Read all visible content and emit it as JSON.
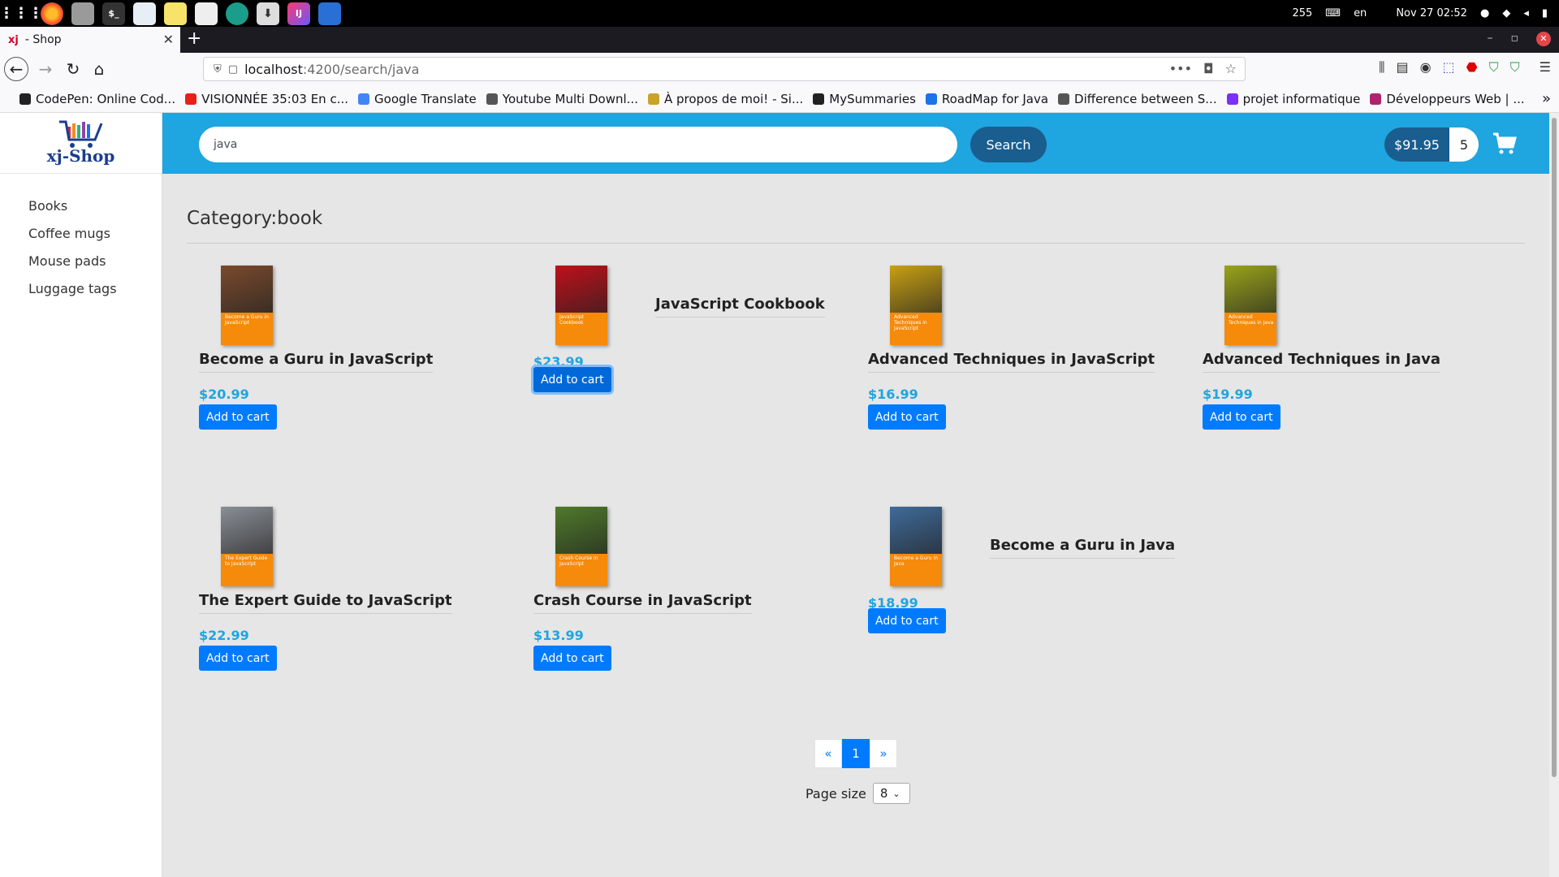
{
  "system": {
    "apps": [
      "grid-icon",
      "firefox-icon",
      "files-icon",
      "terminal-icon",
      "finder-icon",
      "notes-icon",
      "clipboard-icon",
      "chrome-icon",
      "downloads-icon",
      "intellij-icon",
      "docs-icon"
    ],
    "tray": {
      "shield_count": "255",
      "lang": "en",
      "datetime": "Nov 27  02:52"
    }
  },
  "browser": {
    "tab_title": "- Shop",
    "tab_favicon": "xj",
    "url_host": "localhost",
    "url_path": ":4200/search/java",
    "bookmarks": [
      {
        "label": "CodePen: Online Cod...",
        "icon": "codepen-icon",
        "color": "#222"
      },
      {
        "label": "VISIONNÉE 35:03 En c...",
        "icon": "youtube-icon",
        "color": "#e62117"
      },
      {
        "label": "Google Translate",
        "icon": "translate-icon",
        "color": "#4285f4"
      },
      {
        "label": "Youtube Multi Downl...",
        "icon": "globe-icon",
        "color": "#555"
      },
      {
        "label": "À propos de moi! - Si...",
        "icon": "page-icon",
        "color": "#c9a227"
      },
      {
        "label": "MySummaries",
        "icon": "github-icon",
        "color": "#222"
      },
      {
        "label": "RoadMap for Java",
        "icon": "roadmap-icon",
        "color": "#1a73e8"
      },
      {
        "label": "Difference between S...",
        "icon": "diamond-icon",
        "color": "#555"
      },
      {
        "label": "projet informatique",
        "icon": "project-icon",
        "color": "#7b2ff7"
      },
      {
        "label": "Développeurs Web | ...",
        "icon": "web-dev-icon",
        "color": "#b0226d"
      }
    ]
  },
  "app": {
    "logo_text": "xj-Shop",
    "categories": [
      "Books",
      "Coffee mugs",
      "Mouse pads",
      "Luggage tags"
    ],
    "search_value": "java",
    "search_button": "Search",
    "cart_total": "$91.95",
    "cart_quantity": "5",
    "category_heading": "Category:book",
    "add_to_cart": "Add to cart",
    "products": [
      {
        "name": "Become a Guru in JavaScript",
        "price": "$20.99",
        "cover_text": "Become a Guru in JavaScript",
        "cover_color": "#7a4a2c"
      },
      {
        "name": "JavaScript Cookbook",
        "price": "$23.99",
        "cover_text": "JavaScript Cookbook",
        "cover_color": "#c0101a"
      },
      {
        "name": "Advanced Techniques in JavaScript",
        "price": "$16.99",
        "cover_text": "Advanced Techniques in JavaScript",
        "cover_color": "#c8a012"
      },
      {
        "name": "Advanced Techniques in Java",
        "price": "$19.99",
        "cover_text": "Advanced Techniques in Java",
        "cover_color": "#9aa41a"
      },
      {
        "name": "The Expert Guide to JavaScript",
        "price": "$22.99",
        "cover_text": "The Expert Guide to JavaScript",
        "cover_color": "#8a8f96"
      },
      {
        "name": "Crash Course in JavaScript",
        "price": "$13.99",
        "cover_text": "Crash Course in JavaScript",
        "cover_color": "#4f7a2a"
      },
      {
        "name": "Become a Guru in Java",
        "price": "$18.99",
        "cover_text": "Become a Guru in Java",
        "cover_color": "#3f6b9a"
      }
    ],
    "pagination": {
      "prev": "«",
      "current": "1",
      "next": "»"
    },
    "page_size_label": "Page size",
    "page_size_value": "8",
    "accent_color": "#1fa5e0"
  }
}
